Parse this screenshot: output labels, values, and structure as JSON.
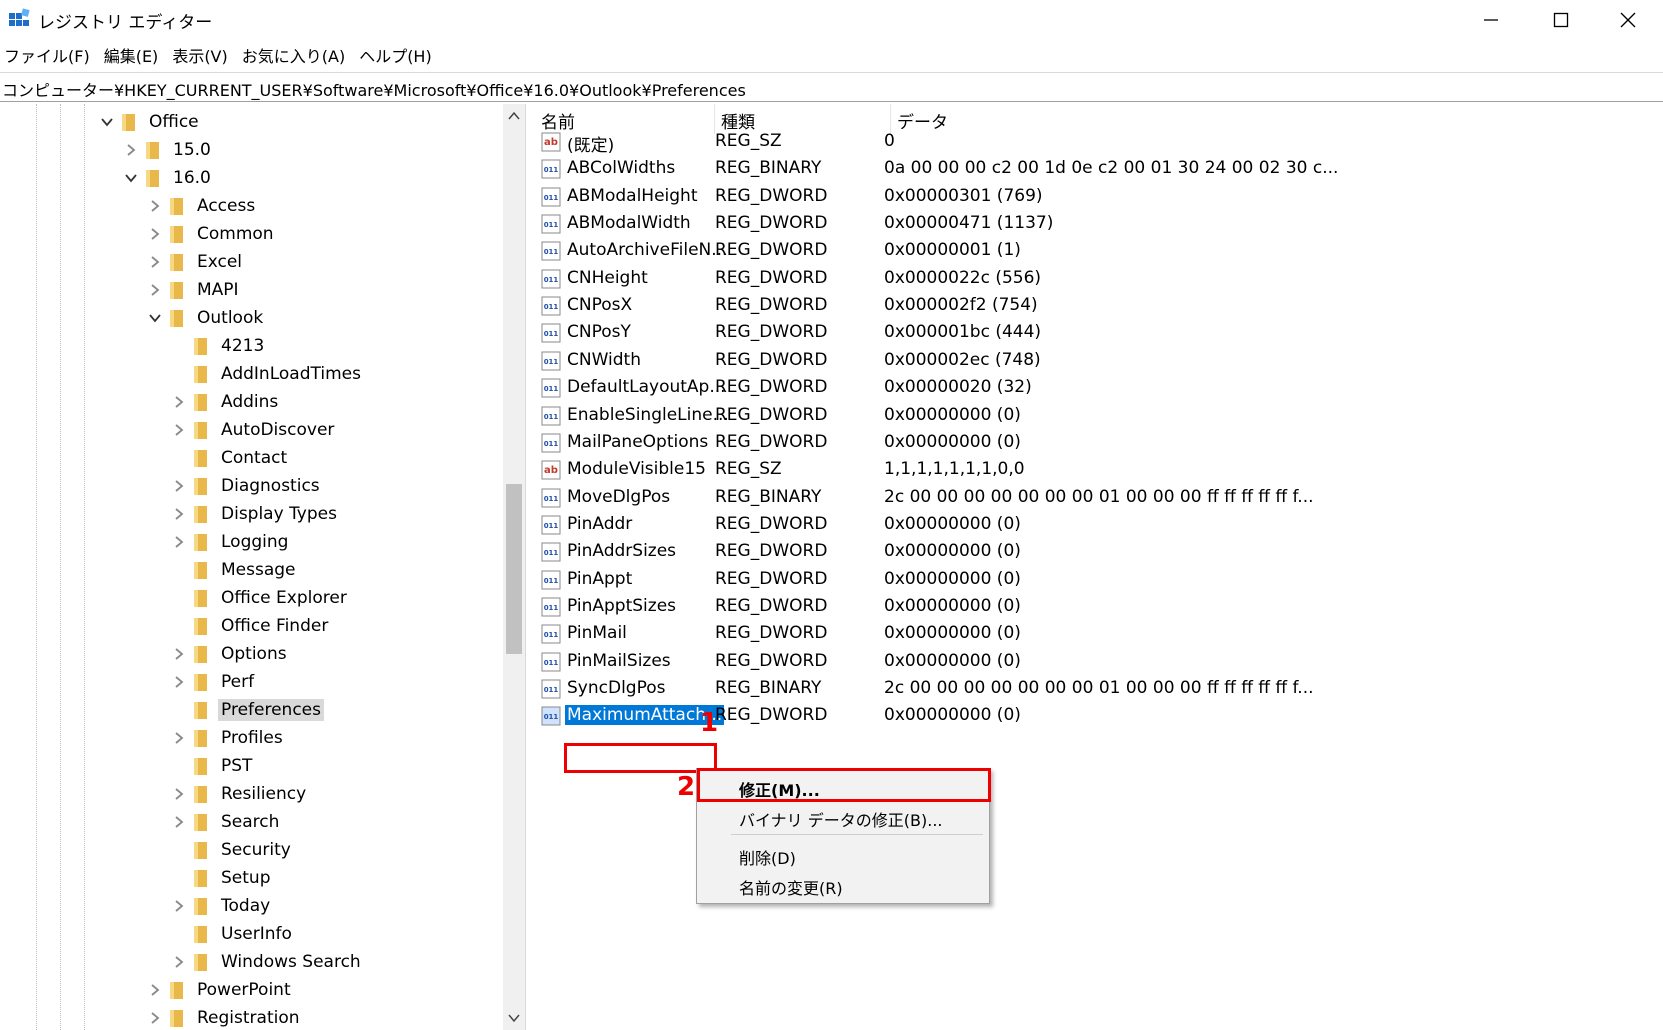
{
  "window": {
    "title": "レジストリ エディター",
    "minimize_glyph": "—",
    "maximize_glyph": "☐",
    "close_glyph": "✕"
  },
  "menu": [
    "ファイル(F)",
    "編集(E)",
    "表示(V)",
    "お気に入り(A)",
    "ヘルプ(H)"
  ],
  "address": "コンピューター¥HKEY_CURRENT_USER¥Software¥Microsoft¥Office¥16.0¥Outlook¥Preferences",
  "tree": [
    {
      "label": "Office",
      "level": 0,
      "chevron": "down"
    },
    {
      "label": "15.0",
      "level": 1,
      "chevron": "right"
    },
    {
      "label": "16.0",
      "level": 1,
      "chevron": "down"
    },
    {
      "label": "Access",
      "level": 2,
      "chevron": "right"
    },
    {
      "label": "Common",
      "level": 2,
      "chevron": "right"
    },
    {
      "label": "Excel",
      "level": 2,
      "chevron": "right"
    },
    {
      "label": "MAPI",
      "level": 2,
      "chevron": "right"
    },
    {
      "label": "Outlook",
      "level": 2,
      "chevron": "down"
    },
    {
      "label": "4213",
      "level": 3,
      "chevron": "none"
    },
    {
      "label": "AddInLoadTimes",
      "level": 3,
      "chevron": "none"
    },
    {
      "label": "Addins",
      "level": 3,
      "chevron": "right"
    },
    {
      "label": "AutoDiscover",
      "level": 3,
      "chevron": "right"
    },
    {
      "label": "Contact",
      "level": 3,
      "chevron": "none"
    },
    {
      "label": "Diagnostics",
      "level": 3,
      "chevron": "right"
    },
    {
      "label": "Display Types",
      "level": 3,
      "chevron": "right"
    },
    {
      "label": "Logging",
      "level": 3,
      "chevron": "right"
    },
    {
      "label": "Message",
      "level": 3,
      "chevron": "none"
    },
    {
      "label": "Office Explorer",
      "level": 3,
      "chevron": "none"
    },
    {
      "label": "Office Finder",
      "level": 3,
      "chevron": "none"
    },
    {
      "label": "Options",
      "level": 3,
      "chevron": "right"
    },
    {
      "label": "Perf",
      "level": 3,
      "chevron": "right"
    },
    {
      "label": "Preferences",
      "level": 3,
      "chevron": "none",
      "selected": true
    },
    {
      "label": "Profiles",
      "level": 3,
      "chevron": "right"
    },
    {
      "label": "PST",
      "level": 3,
      "chevron": "none"
    },
    {
      "label": "Resiliency",
      "level": 3,
      "chevron": "right"
    },
    {
      "label": "Search",
      "level": 3,
      "chevron": "right"
    },
    {
      "label": "Security",
      "level": 3,
      "chevron": "none"
    },
    {
      "label": "Setup",
      "level": 3,
      "chevron": "none"
    },
    {
      "label": "Today",
      "level": 3,
      "chevron": "right"
    },
    {
      "label": "UserInfo",
      "level": 3,
      "chevron": "none"
    },
    {
      "label": "Windows Search",
      "level": 3,
      "chevron": "right"
    },
    {
      "label": "PowerPoint",
      "level": 2,
      "chevron": "right"
    },
    {
      "label": "Registration",
      "level": 2,
      "chevron": "right"
    }
  ],
  "list": {
    "headers": {
      "name": "名前",
      "type": "種類",
      "data": "データ"
    },
    "rows": [
      {
        "name": "(既定)",
        "type": "REG_SZ",
        "data": "0",
        "icon": "string"
      },
      {
        "name": "ABColWidths",
        "type": "REG_BINARY",
        "data": "0a 00 00 00 c2 00 1d 0e c2 00 01 30 24 00 02 30 c...",
        "icon": "binary"
      },
      {
        "name": "ABModalHeight",
        "type": "REG_DWORD",
        "data": "0x00000301 (769)",
        "icon": "binary"
      },
      {
        "name": "ABModalWidth",
        "type": "REG_DWORD",
        "data": "0x00000471 (1137)",
        "icon": "binary"
      },
      {
        "name": "AutoArchiveFileN...",
        "type": "REG_DWORD",
        "data": "0x00000001 (1)",
        "icon": "binary"
      },
      {
        "name": "CNHeight",
        "type": "REG_DWORD",
        "data": "0x0000022c (556)",
        "icon": "binary"
      },
      {
        "name": "CNPosX",
        "type": "REG_DWORD",
        "data": "0x000002f2 (754)",
        "icon": "binary"
      },
      {
        "name": "CNPosY",
        "type": "REG_DWORD",
        "data": "0x000001bc (444)",
        "icon": "binary"
      },
      {
        "name": "CNWidth",
        "type": "REG_DWORD",
        "data": "0x000002ec (748)",
        "icon": "binary"
      },
      {
        "name": "DefaultLayoutAp...",
        "type": "REG_DWORD",
        "data": "0x00000020 (32)",
        "icon": "binary"
      },
      {
        "name": "EnableSingleLine...",
        "type": "REG_DWORD",
        "data": "0x00000000 (0)",
        "icon": "binary"
      },
      {
        "name": "MailPaneOptions",
        "type": "REG_DWORD",
        "data": "0x00000000 (0)",
        "icon": "binary"
      },
      {
        "name": "ModuleVisible15",
        "type": "REG_SZ",
        "data": "1,1,1,1,1,1,1,0,0",
        "icon": "string"
      },
      {
        "name": "MoveDlgPos",
        "type": "REG_BINARY",
        "data": "2c 00 00 00 00 00 00 00 01 00 00 00 ff ff ff ff ff f...",
        "icon": "binary"
      },
      {
        "name": "PinAddr",
        "type": "REG_DWORD",
        "data": "0x00000000 (0)",
        "icon": "binary"
      },
      {
        "name": "PinAddrSizes",
        "type": "REG_DWORD",
        "data": "0x00000000 (0)",
        "icon": "binary"
      },
      {
        "name": "PinAppt",
        "type": "REG_DWORD",
        "data": "0x00000000 (0)",
        "icon": "binary"
      },
      {
        "name": "PinApptSizes",
        "type": "REG_DWORD",
        "data": "0x00000000 (0)",
        "icon": "binary"
      },
      {
        "name": "PinMail",
        "type": "REG_DWORD",
        "data": "0x00000000 (0)",
        "icon": "binary"
      },
      {
        "name": "PinMailSizes",
        "type": "REG_DWORD",
        "data": "0x00000000 (0)",
        "icon": "binary"
      },
      {
        "name": "SyncDlgPos",
        "type": "REG_BINARY",
        "data": "2c 00 00 00 00 00 00 00 01 00 00 00 ff ff ff ff ff f...",
        "icon": "binary"
      },
      {
        "name": "MaximumAttach...",
        "type": "REG_DWORD",
        "data": "0x00000000 (0)",
        "icon": "binary",
        "selected": true
      }
    ]
  },
  "context_menu": {
    "modify": "修正(M)...",
    "modify_binary": "バイナリ データの修正(B)...",
    "delete": "削除(D)",
    "rename": "名前の変更(R)"
  },
  "annotations": {
    "step1": "1",
    "step2": "2",
    "color": "#e00000"
  },
  "colors": {
    "selection": "#0078d7",
    "folder": "#e8b84a",
    "tree_selected": "#d9d9d9"
  }
}
